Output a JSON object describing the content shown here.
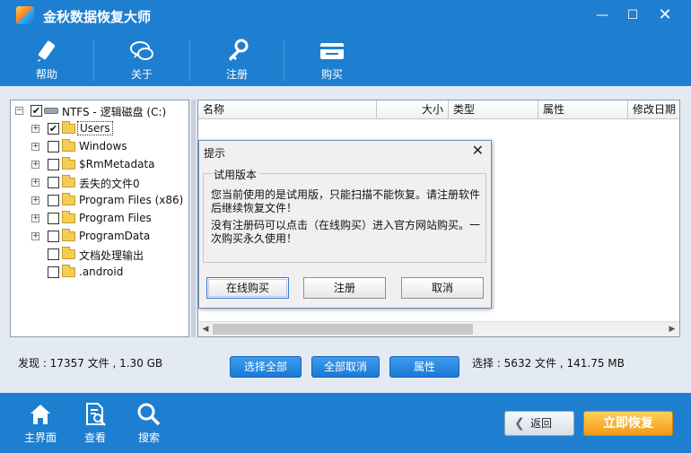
{
  "app": {
    "title": "金秋数据恢复大师"
  },
  "window_controls": {
    "minimize": "—",
    "maximize": "☐",
    "close": "✕"
  },
  "toolbar": {
    "items": [
      {
        "label": "帮助",
        "icon": "pen-icon"
      },
      {
        "label": "关于",
        "icon": "chat-bubbles-icon"
      },
      {
        "label": "注册",
        "icon": "key-icon"
      },
      {
        "label": "购买",
        "icon": "card-icon"
      }
    ]
  },
  "tree": {
    "root": {
      "label": "NTFS - 逻辑磁盘 (C:)",
      "checked": true
    },
    "items": [
      {
        "label": "Users",
        "checked": true,
        "expandable": true,
        "selected": true
      },
      {
        "label": "Windows",
        "checked": false,
        "expandable": true
      },
      {
        "label": "$RmMetadata",
        "checked": false,
        "expandable": true
      },
      {
        "label": "丢失的文件0",
        "checked": false,
        "expandable": true
      },
      {
        "label": "Program Files (x86)",
        "checked": false,
        "expandable": true
      },
      {
        "label": "Program Files",
        "checked": false,
        "expandable": true
      },
      {
        "label": "ProgramData",
        "checked": false,
        "expandable": true
      },
      {
        "label": "文档处理输出",
        "checked": false,
        "expandable": false
      },
      {
        "label": ".android",
        "checked": false,
        "expandable": false
      }
    ],
    "expand_glyph": "+",
    "check_glyph": "✔"
  },
  "filelist": {
    "columns": [
      "名称",
      "大小",
      "类型",
      "属性",
      "修改日期"
    ],
    "scroll_left": "◀",
    "scroll_right": "▶"
  },
  "status": {
    "found": "发现 : 17357 文件 , 1.30 GB",
    "selected": "选择 : 5632 文件 , 141.75 MB",
    "select_all": "选择全部",
    "deselect_all": "全部取消",
    "properties": "属性"
  },
  "bottom_nav": {
    "items": [
      {
        "label": "主界面",
        "icon": "home-icon"
      },
      {
        "label": "查看",
        "icon": "document-search-icon"
      },
      {
        "label": "搜索",
        "icon": "magnifier-icon"
      }
    ],
    "back": "返回",
    "back_arrow": "❮",
    "recover": "立即恢复"
  },
  "dialog": {
    "title": "提示",
    "close": "✕",
    "group_title": "试用版本",
    "message1": "您当前使用的是试用版，只能扫描不能恢复。请注册软件后继续恢复文件！",
    "message2": "没有注册码可以点击（在线购买）进入官方网站购买。一次购买永久使用！",
    "buttons": {
      "buy": "在线购买",
      "register": "注册",
      "cancel": "取消"
    }
  },
  "colors": {
    "brand_blue": "#1e7fd0",
    "accent_orange": "#f29a16"
  }
}
